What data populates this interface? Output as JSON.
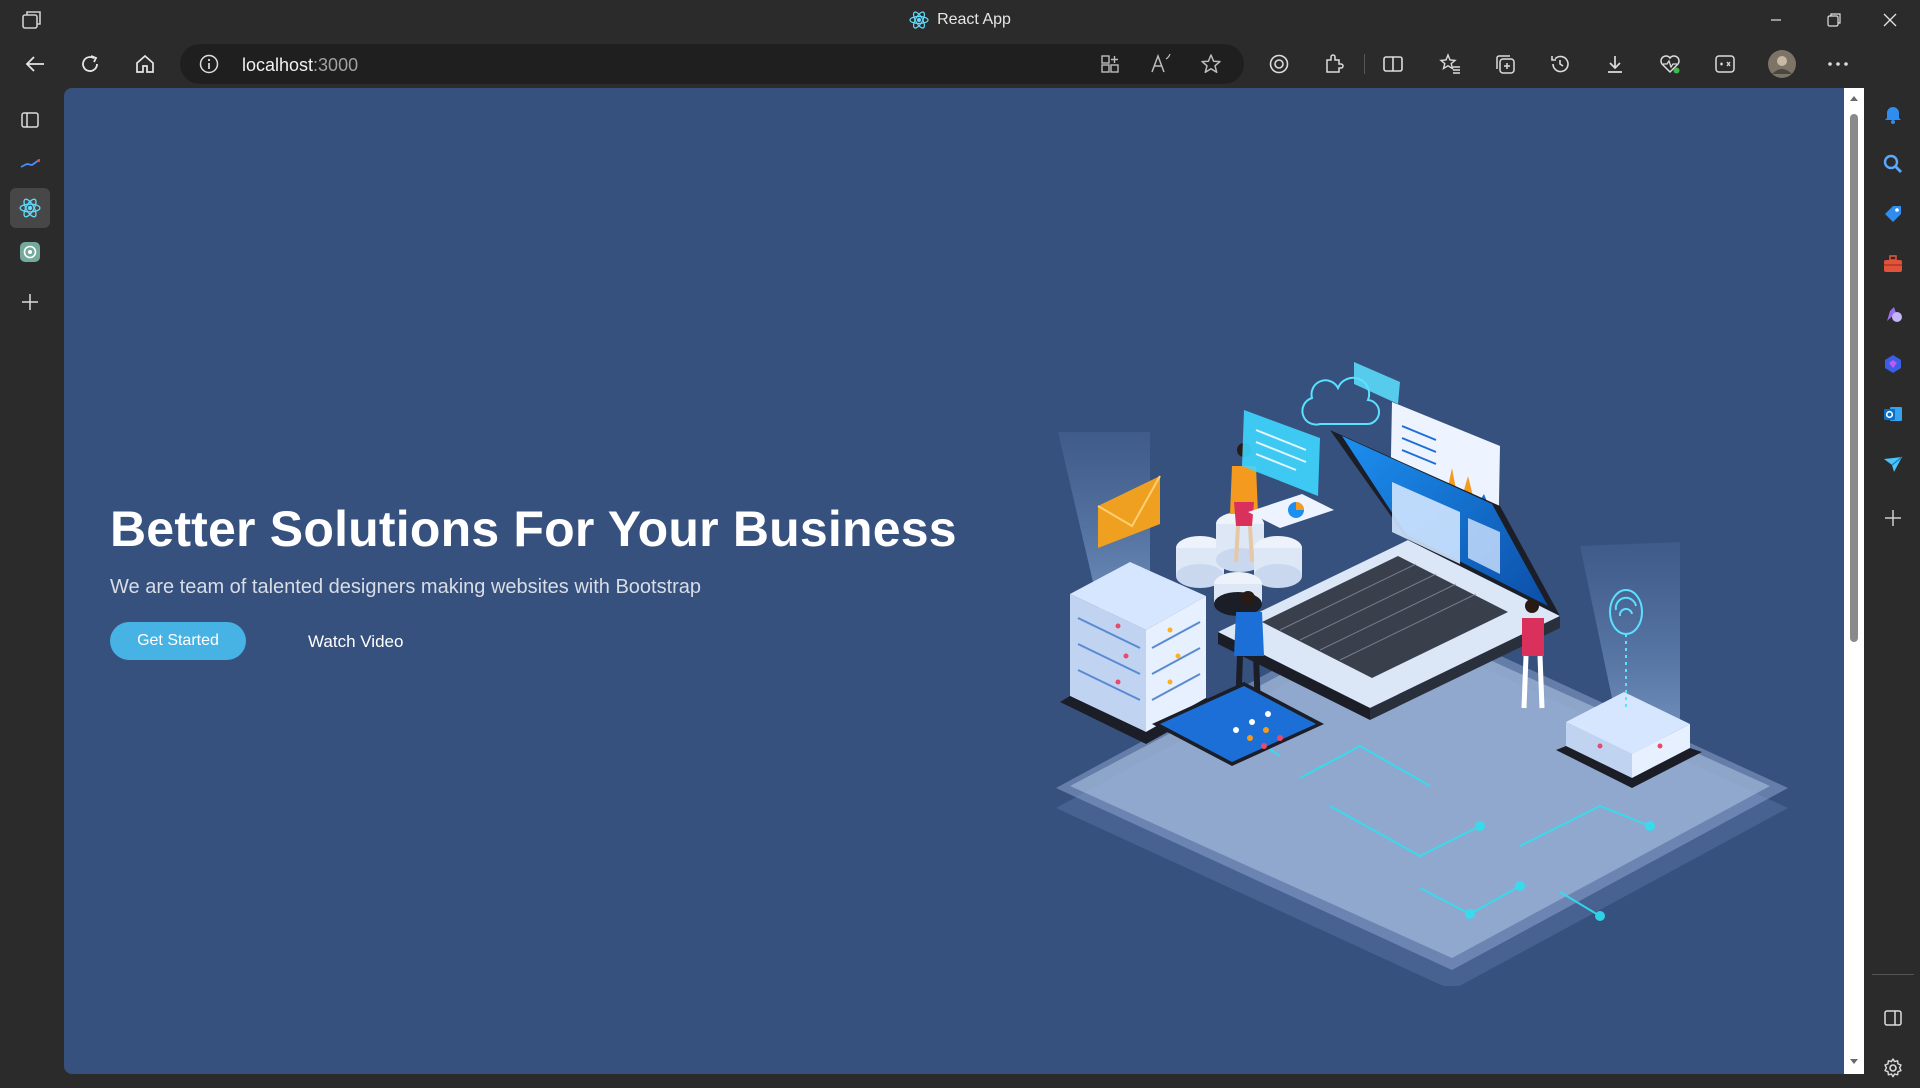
{
  "window": {
    "title": "React App",
    "controls": [
      "minimize-icon",
      "restore-icon",
      "close-icon"
    ]
  },
  "toolbar": {
    "url_host": "localhost",
    "url_port": ":3000",
    "left_icons": [
      "back-arrow-icon",
      "refresh-icon",
      "home-icon"
    ],
    "address_icons": [
      "site-info-icon",
      "app-available-icon",
      "read-aloud-icon",
      "favorite-star-icon"
    ],
    "right_icons": [
      "tracking-prevention-icon",
      "extensions-icon",
      "split-screen-icon",
      "favorites-icon",
      "collections-icon",
      "history-icon",
      "downloads-icon",
      "browser-essentials-icon",
      "math-solver-icon",
      "profile-avatar",
      "more-options-icon",
      "bing-copilot-icon"
    ]
  },
  "tabs": [
    {
      "name": "tab-actions-icon"
    },
    {
      "name": "tab-analytics"
    },
    {
      "name": "tab-react-app",
      "active": true
    },
    {
      "name": "tab-chatgpt"
    },
    {
      "name": "new-tab-icon"
    }
  ],
  "hero": {
    "title": "Better Solutions For Your Business",
    "subtitle": "We are team of talented designers making websites with Bootstrap",
    "primary_button": "Get Started",
    "secondary_button": "Watch Video"
  },
  "sidebar": {
    "icons": [
      "notifications-icon",
      "search-icon",
      "shopping-icon",
      "tools-icon",
      "games-icon",
      "microsoft-365-icon",
      "outlook-icon",
      "telegram-icon",
      "add-icon"
    ],
    "bottom_icons": [
      "hide-sidebar-icon",
      "settings-icon"
    ]
  },
  "colors": {
    "hero_background": "#37517e",
    "accent_button": "#47b2e4",
    "browser_chrome": "#2b2b2b"
  }
}
